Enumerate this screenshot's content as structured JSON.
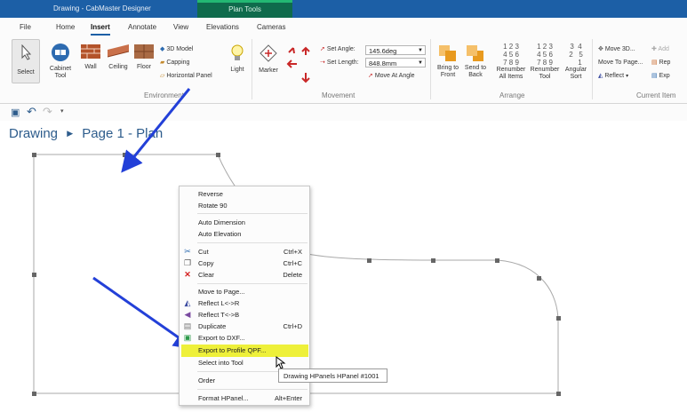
{
  "app": {
    "title": "Drawing - CabMaster Designer",
    "contextual_tab": "Plan Tools"
  },
  "menu": [
    "File",
    "Home",
    "Insert",
    "Annotate",
    "View",
    "Elevations",
    "Cameras"
  ],
  "ribbon": {
    "select": "Select",
    "cabinet_tool": "Cabinet Tool",
    "wall": "Wall",
    "ceiling": "Ceiling",
    "floor": "Floor",
    "model3d": "3D Model",
    "capping": "Capping",
    "horizontal_panel": "Horizontal Panel",
    "light": "Light",
    "environment_group": "Environment",
    "marker": "Marker",
    "set_angle_label": "Set Angle:",
    "set_angle_value": "145.6deg",
    "set_length_label": "Set Length:",
    "set_length_value": "848.8mm",
    "move_at_angle": "Move At Angle",
    "movement_group": "Movement",
    "bring_to_front": "Bring to Front",
    "send_to_back": "Send to Back",
    "renumber_all": "Renumber All Items",
    "renumber_tool": "Renumber Tool",
    "angular_sort": "Angular Sort",
    "arrange_group": "Arrange",
    "move_3d": "Move 3D...",
    "move_to_page": "Move To Page...",
    "reflect": "Reflect",
    "add": "Add",
    "rep": "Rep",
    "exp": "Exp",
    "current_item_group": "Current Item"
  },
  "renumber_glyphs": {
    "all_items": "1 2 3\n4 5 6\n7 8 9",
    "tool": "1 2 3\n4 5 6\n7 8 9",
    "angular": "3  4\n2   5\n    1"
  },
  "breadcrumb": {
    "part1": "Drawing",
    "part2": "Page 1 - Plan"
  },
  "context_menu": {
    "items": [
      {
        "label": "Reverse",
        "shortcut": ""
      },
      {
        "label": "Rotate 90",
        "shortcut": ""
      },
      {
        "label": "Auto Dimension",
        "shortcut": ""
      },
      {
        "label": "Auto Elevation",
        "shortcut": ""
      },
      {
        "label": "Cut",
        "shortcut": "Ctrl+X"
      },
      {
        "label": "Copy",
        "shortcut": "Ctrl+C"
      },
      {
        "label": "Clear",
        "shortcut": "Delete"
      },
      {
        "label": "Move to Page...",
        "shortcut": ""
      },
      {
        "label": "Reflect L<->R",
        "shortcut": ""
      },
      {
        "label": "Reflect T<->B",
        "shortcut": ""
      },
      {
        "label": "Duplicate",
        "shortcut": "Ctrl+D"
      },
      {
        "label": "Export to DXF...",
        "shortcut": ""
      },
      {
        "label": "Export to Profile QPF...",
        "shortcut": ""
      },
      {
        "label": "Select into Tool",
        "shortcut": ""
      },
      {
        "label": "Order",
        "shortcut": ""
      },
      {
        "label": "Format HPanel...",
        "shortcut": "Alt+Enter"
      }
    ]
  },
  "tooltip": "Drawing HPanels HPanel #1001",
  "colors": {
    "title_bar": "#1c5fa6",
    "plan_tools": "#0f6b4c",
    "highlight": "#eef03a",
    "arrow": "#2340d8"
  }
}
